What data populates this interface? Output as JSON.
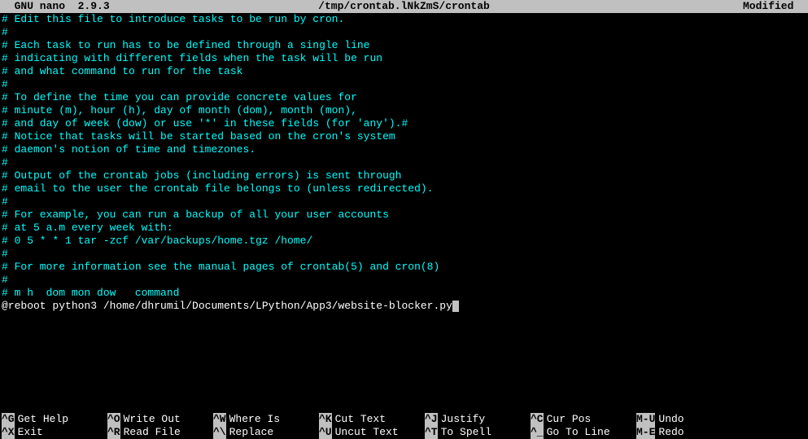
{
  "header": {
    "app_name": "  GNU nano  2.9.3",
    "file_path": "/tmp/crontab.lNkZmS/crontab",
    "status": "Modified  "
  },
  "lines": [
    {
      "type": "comment",
      "text": "# Edit this file to introduce tasks to be run by cron."
    },
    {
      "type": "comment",
      "text": "#"
    },
    {
      "type": "comment",
      "text": "# Each task to run has to be defined through a single line"
    },
    {
      "type": "comment",
      "text": "# indicating with different fields when the task will be run"
    },
    {
      "type": "comment",
      "text": "# and what command to run for the task"
    },
    {
      "type": "comment",
      "text": "#"
    },
    {
      "type": "comment",
      "text": "# To define the time you can provide concrete values for"
    },
    {
      "type": "comment",
      "text": "# minute (m), hour (h), day of month (dom), month (mon),"
    },
    {
      "type": "comment",
      "text": "# and day of week (dow) or use '*' in these fields (for 'any').#"
    },
    {
      "type": "comment",
      "text": "# Notice that tasks will be started based on the cron's system"
    },
    {
      "type": "comment",
      "text": "# daemon's notion of time and timezones."
    },
    {
      "type": "comment",
      "text": "#"
    },
    {
      "type": "comment",
      "text": "# Output of the crontab jobs (including errors) is sent through"
    },
    {
      "type": "comment",
      "text": "# email to the user the crontab file belongs to (unless redirected)."
    },
    {
      "type": "comment",
      "text": "#"
    },
    {
      "type": "comment",
      "text": "# For example, you can run a backup of all your user accounts"
    },
    {
      "type": "comment",
      "text": "# at 5 a.m every week with:"
    },
    {
      "type": "comment",
      "text": "# 0 5 * * 1 tar -zcf /var/backups/home.tgz /home/"
    },
    {
      "type": "comment",
      "text": "#"
    },
    {
      "type": "comment",
      "text": "# For more information see the manual pages of crontab(5) and cron(8)"
    },
    {
      "type": "comment",
      "text": "#"
    },
    {
      "type": "comment",
      "text": "# m h  dom mon dow   command"
    },
    {
      "type": "code",
      "text": "@reboot python3 /home/dhrumil/Documents/LPython/App3/website-blocker.py",
      "cursor": true
    }
  ],
  "shortcuts": {
    "row1": [
      {
        "key": "^G",
        "label": "Get Help"
      },
      {
        "key": "^O",
        "label": "Write Out"
      },
      {
        "key": "^W",
        "label": "Where Is"
      },
      {
        "key": "^K",
        "label": "Cut Text"
      },
      {
        "key": "^J",
        "label": "Justify"
      },
      {
        "key": "^C",
        "label": "Cur Pos"
      },
      {
        "key": "M-U",
        "label": "Undo"
      }
    ],
    "row2": [
      {
        "key": "^X",
        "label": "Exit"
      },
      {
        "key": "^R",
        "label": "Read File"
      },
      {
        "key": "^\\",
        "label": "Replace"
      },
      {
        "key": "^U",
        "label": "Uncut Text"
      },
      {
        "key": "^T",
        "label": "To Spell"
      },
      {
        "key": "^_",
        "label": "Go To Line"
      },
      {
        "key": "M-E",
        "label": "Redo"
      }
    ]
  }
}
